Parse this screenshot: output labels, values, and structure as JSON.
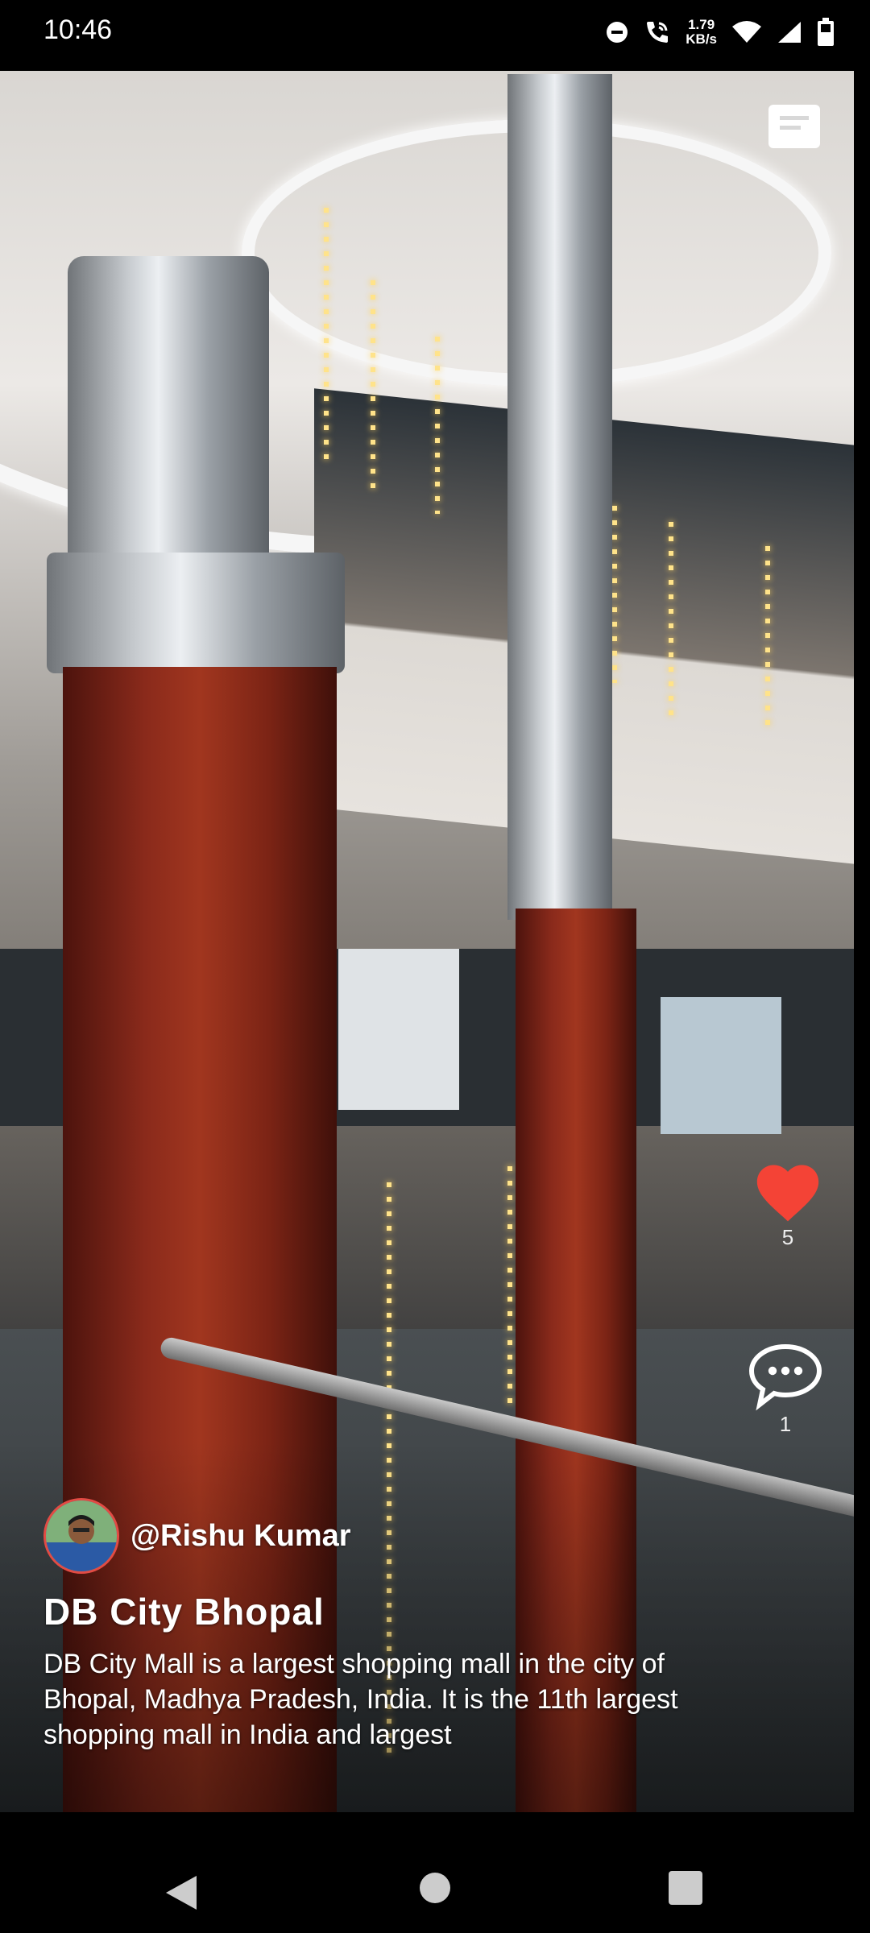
{
  "status_bar": {
    "time": "10:46",
    "net_speed_value": "1.79",
    "net_speed_unit": "KB/s",
    "icons": [
      "do-not-disturb-icon",
      "wifi-calling-icon",
      "wifi-icon",
      "signal-icon",
      "battery-icon"
    ]
  },
  "video": {
    "caption_icon": "caption-icon"
  },
  "actions": {
    "like_icon": "heart-icon",
    "like_color": "#f44336",
    "like_count": "5",
    "comment_icon": "comment-icon",
    "comment_count": "1"
  },
  "post": {
    "username": "@Rishu Kumar",
    "title": "DB City Bhopal",
    "description": "DB City Mall is a largest shopping mall in the city of Bhopal, Madhya Pradesh, India. It is the 11th largest shopping mall in India and largest"
  },
  "nav_bar": {
    "icons": [
      "back-icon",
      "home-icon",
      "recents-icon"
    ]
  }
}
